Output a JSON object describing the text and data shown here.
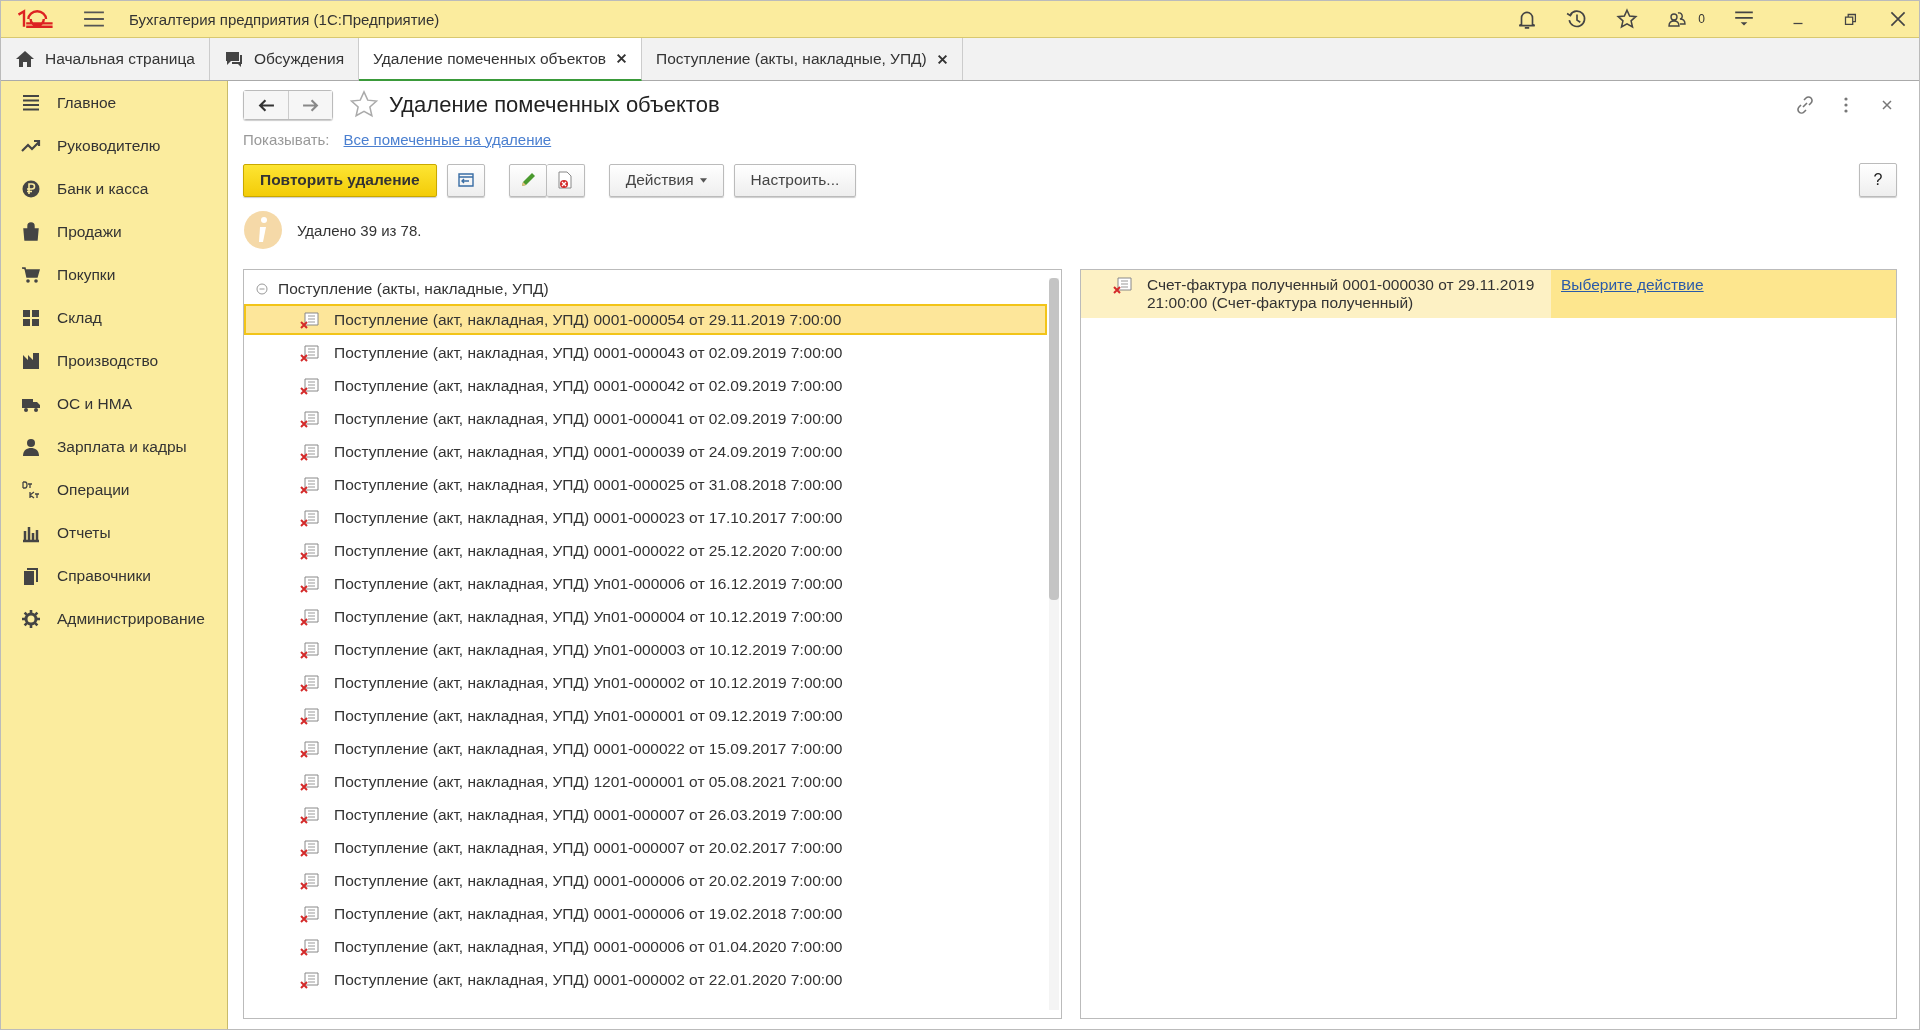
{
  "window": {
    "title": "Бухгалтерия предприятия  (1С:Предприятие)",
    "user_count": "0"
  },
  "tabs": [
    {
      "label": "Начальная страница",
      "selected": false,
      "closable": false
    },
    {
      "label": "Обсуждения",
      "selected": false,
      "closable": false
    },
    {
      "label": "Удаление помеченных объектов",
      "selected": true,
      "closable": true
    },
    {
      "label": "Поступление (акты, накладные, УПД)",
      "selected": false,
      "closable": true
    }
  ],
  "sidebar": {
    "items": [
      {
        "label": "Главное"
      },
      {
        "label": "Руководителю"
      },
      {
        "label": "Банк и касса"
      },
      {
        "label": "Продажи"
      },
      {
        "label": "Покупки"
      },
      {
        "label": "Склад"
      },
      {
        "label": "Производство"
      },
      {
        "label": "ОС и НМА"
      },
      {
        "label": "Зарплата и кадры"
      },
      {
        "label": "Операции"
      },
      {
        "label": "Отчеты"
      },
      {
        "label": "Справочники"
      },
      {
        "label": "Администрирование"
      }
    ]
  },
  "form": {
    "title": "Удаление помеченных объектов",
    "show_label": "Показывать:",
    "show_link": "Все помеченные на удаление",
    "primary_button": "Повторить удаление",
    "actions_button": "Действия",
    "settings_button": "Настроить...",
    "help_button": "?",
    "info": "Удалено 39 из 78."
  },
  "tree": {
    "group": {
      "label": "Поступление (акты, накладные, УПД)",
      "expanded": true,
      "children": [
        {
          "label": "Поступление (акт, накладная, УПД) 0001-000054 от 29.11.2019 7:00:00",
          "selected": true
        },
        {
          "label": "Поступление (акт, накладная, УПД) 0001-000043 от 02.09.2019 7:00:00",
          "selected": false
        },
        {
          "label": "Поступление (акт, накладная, УПД) 0001-000042 от 02.09.2019 7:00:00",
          "selected": false
        },
        {
          "label": "Поступление (акт, накладная, УПД) 0001-000041 от 02.09.2019 7:00:00",
          "selected": false
        },
        {
          "label": "Поступление (акт, накладная, УПД) 0001-000039 от 24.09.2019 7:00:00",
          "selected": false
        },
        {
          "label": "Поступление (акт, накладная, УПД) 0001-000025 от 31.08.2018 7:00:00",
          "selected": false
        },
        {
          "label": "Поступление (акт, накладная, УПД) 0001-000023 от 17.10.2017 7:00:00",
          "selected": false
        },
        {
          "label": "Поступление (акт, накладная, УПД) 0001-000022 от 25.12.2020 7:00:00",
          "selected": false
        },
        {
          "label": "Поступление (акт, накладная, УПД) Уп01-000006 от 16.12.2019 7:00:00",
          "selected": false
        },
        {
          "label": "Поступление (акт, накладная, УПД) Уп01-000004 от 10.12.2019 7:00:00",
          "selected": false
        },
        {
          "label": "Поступление (акт, накладная, УПД) Уп01-000003 от 10.12.2019 7:00:00",
          "selected": false
        },
        {
          "label": "Поступление (акт, накладная, УПД) Уп01-000002 от 10.12.2019 7:00:00",
          "selected": false
        },
        {
          "label": "Поступление (акт, накладная, УПД) Уп01-000001 от 09.12.2019 7:00:00",
          "selected": false
        },
        {
          "label": "Поступление (акт, накладная, УПД) 0001-000022 от 15.09.2017 7:00:00",
          "selected": false
        },
        {
          "label": "Поступление (акт, накладная, УПД) 1201-000001 от 05.08.2021 7:00:00",
          "selected": false
        },
        {
          "label": "Поступление (акт, накладная, УПД) 0001-000007 от 26.03.2019 7:00:00",
          "selected": false
        },
        {
          "label": "Поступление (акт, накладная, УПД) 0001-000007 от 20.02.2017 7:00:00",
          "selected": false
        },
        {
          "label": "Поступление (акт, накладная, УПД) 0001-000006 от 20.02.2019 7:00:00",
          "selected": false
        },
        {
          "label": "Поступление (акт, накладная, УПД) 0001-000006 от 19.02.2018 7:00:00",
          "selected": false
        },
        {
          "label": "Поступление (акт, накладная, УПД) 0001-000006 от 01.04.2020 7:00:00",
          "selected": false
        },
        {
          "label": "Поступление (акт, накладная, УПД) 0001-000002 от 22.01.2020 7:00:00",
          "selected": false
        }
      ]
    }
  },
  "references": [
    {
      "label": "Счет-фактура полученный 0001-000030 от 29.11.2019 21:00:00 (Счет-фактура полученный)",
      "action": "Выберите действие"
    }
  ]
}
